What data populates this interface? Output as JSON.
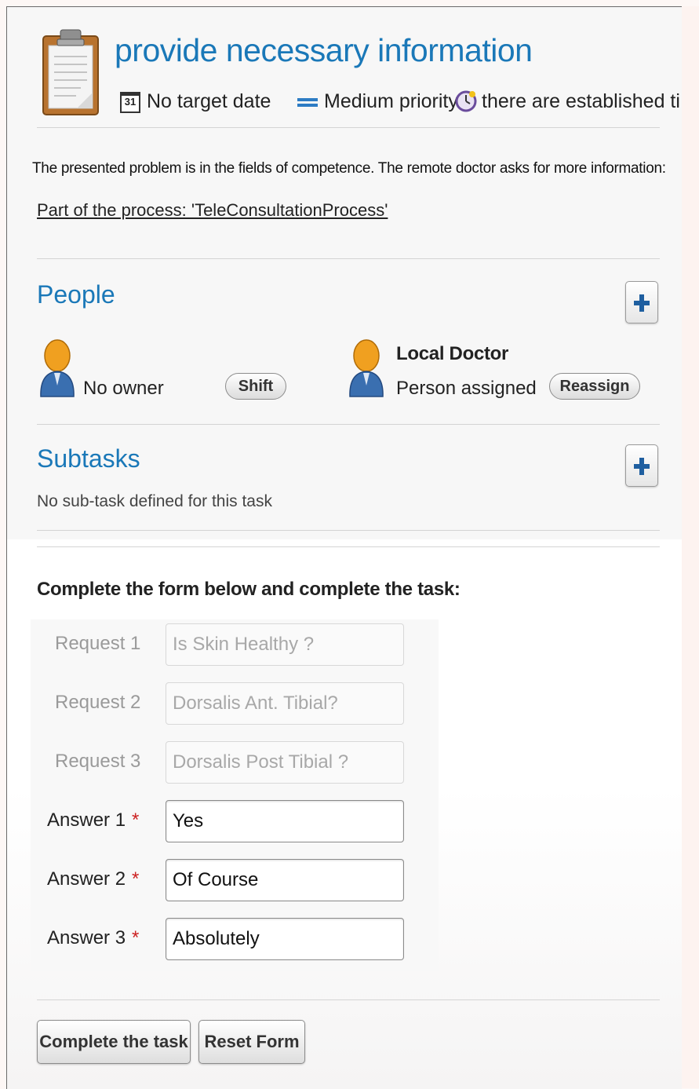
{
  "header": {
    "title": "provide necessary information",
    "calendar_day": "31",
    "target_date": "No target date",
    "priority": "Medium priority",
    "timing": "there are established ti"
  },
  "description": "The presented problem is in the fields of competence. The remote doctor asks for more  information:",
  "process_link": "Part of the process: 'TeleConsultationProcess'",
  "people": {
    "title": "People",
    "owner": {
      "label": "No owner",
      "button": "Shift"
    },
    "assignee": {
      "name": "Local Doctor",
      "status": "Person assigned",
      "button": "Reassign"
    }
  },
  "subtasks": {
    "title": "Subtasks",
    "empty_text": "No sub-task defined for this task"
  },
  "form": {
    "heading": "Complete the form below and complete the task:",
    "requests": [
      {
        "label": "Request 1",
        "value": "Is Skin Healthy ?"
      },
      {
        "label": "Request 2",
        "value": "Dorsalis Ant. Tibial?"
      },
      {
        "label": "Request 3",
        "value": "Dorsalis Post Tibial ?"
      }
    ],
    "answers": [
      {
        "label": "Answer 1",
        "required_mark": "*",
        "value": "Yes"
      },
      {
        "label": "Answer 2",
        "required_mark": "*",
        "value": "Of Course"
      },
      {
        "label": "Answer 3",
        "required_mark": "*",
        "value": "Absolutely"
      }
    ]
  },
  "actions": {
    "complete": "Complete the task",
    "reset": "Reset Form"
  },
  "colors": {
    "accent_blue": "#1a78b8",
    "required_red": "#cc2222"
  }
}
